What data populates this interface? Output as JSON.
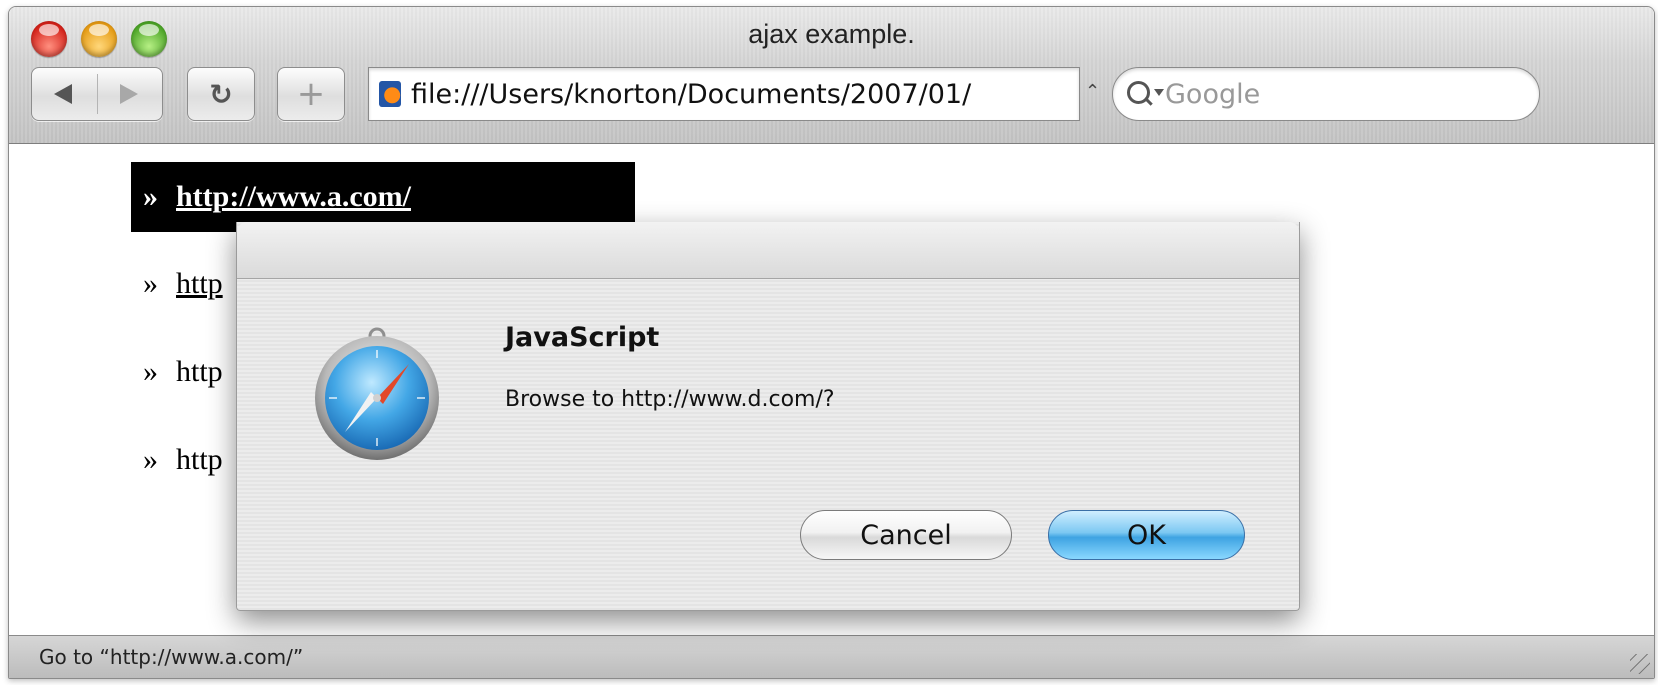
{
  "window": {
    "title": "ajax example."
  },
  "toolbar": {
    "back_icon": "back-arrow-icon",
    "forward_icon": "forward-arrow-icon",
    "reload_glyph": "↻",
    "add_bookmark_glyph": "+",
    "url": "file:///Users/knorton/Documents/2007/01/",
    "url_dropdown_glyph": "⌃",
    "search_placeholder": "Google"
  },
  "content": {
    "bullet": "»",
    "links": [
      {
        "label": "http://www.a.com/",
        "active": true
      },
      {
        "label": "http",
        "active": false
      },
      {
        "label": "http",
        "active": false
      },
      {
        "label": "http",
        "active": false
      }
    ]
  },
  "dialog": {
    "title": "JavaScript",
    "message": "Browse to http://www.d.com/?",
    "cancel_label": "Cancel",
    "ok_label": "OK"
  },
  "status": {
    "text": "Go to “http://www.a.com/”"
  },
  "colors": {
    "ok_button": "#3ea3e2",
    "selected_link_bg": "#000000"
  }
}
